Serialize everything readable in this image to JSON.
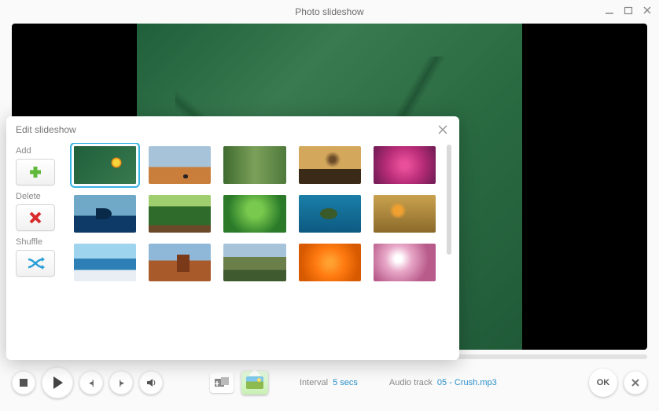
{
  "window": {
    "title": "Photo slideshow"
  },
  "popup": {
    "title": "Edit slideshow",
    "side": {
      "add": "Add",
      "delete": "Delete",
      "shuffle": "Shuffle"
    },
    "thumbs": [
      {
        "id": "toucan",
        "selected": true,
        "cls": "t0"
      },
      {
        "id": "desert",
        "selected": false,
        "cls": "t1"
      },
      {
        "id": "stream",
        "selected": false,
        "cls": "t2"
      },
      {
        "id": "tree",
        "selected": false,
        "cls": "t3"
      },
      {
        "id": "flowers-pink",
        "selected": false,
        "cls": "t4"
      },
      {
        "id": "whale",
        "selected": false,
        "cls": "t5"
      },
      {
        "id": "path",
        "selected": false,
        "cls": "t6"
      },
      {
        "id": "shrub",
        "selected": false,
        "cls": "t7"
      },
      {
        "id": "turtle",
        "selected": false,
        "cls": "t8"
      },
      {
        "id": "leaves",
        "selected": false,
        "cls": "t9"
      },
      {
        "id": "island",
        "selected": false,
        "cls": "t10"
      },
      {
        "id": "monument",
        "selected": false,
        "cls": "t11"
      },
      {
        "id": "meadow",
        "selected": false,
        "cls": "t12"
      },
      {
        "id": "marigold",
        "selected": false,
        "cls": "t13"
      },
      {
        "id": "blossom",
        "selected": false,
        "cls": "t14"
      }
    ]
  },
  "controls": {
    "interval_label": "Interval",
    "interval_value": "5 secs",
    "audio_label": "Audio track",
    "audio_value": "05 - Crush.mp3",
    "ok": "OK"
  }
}
